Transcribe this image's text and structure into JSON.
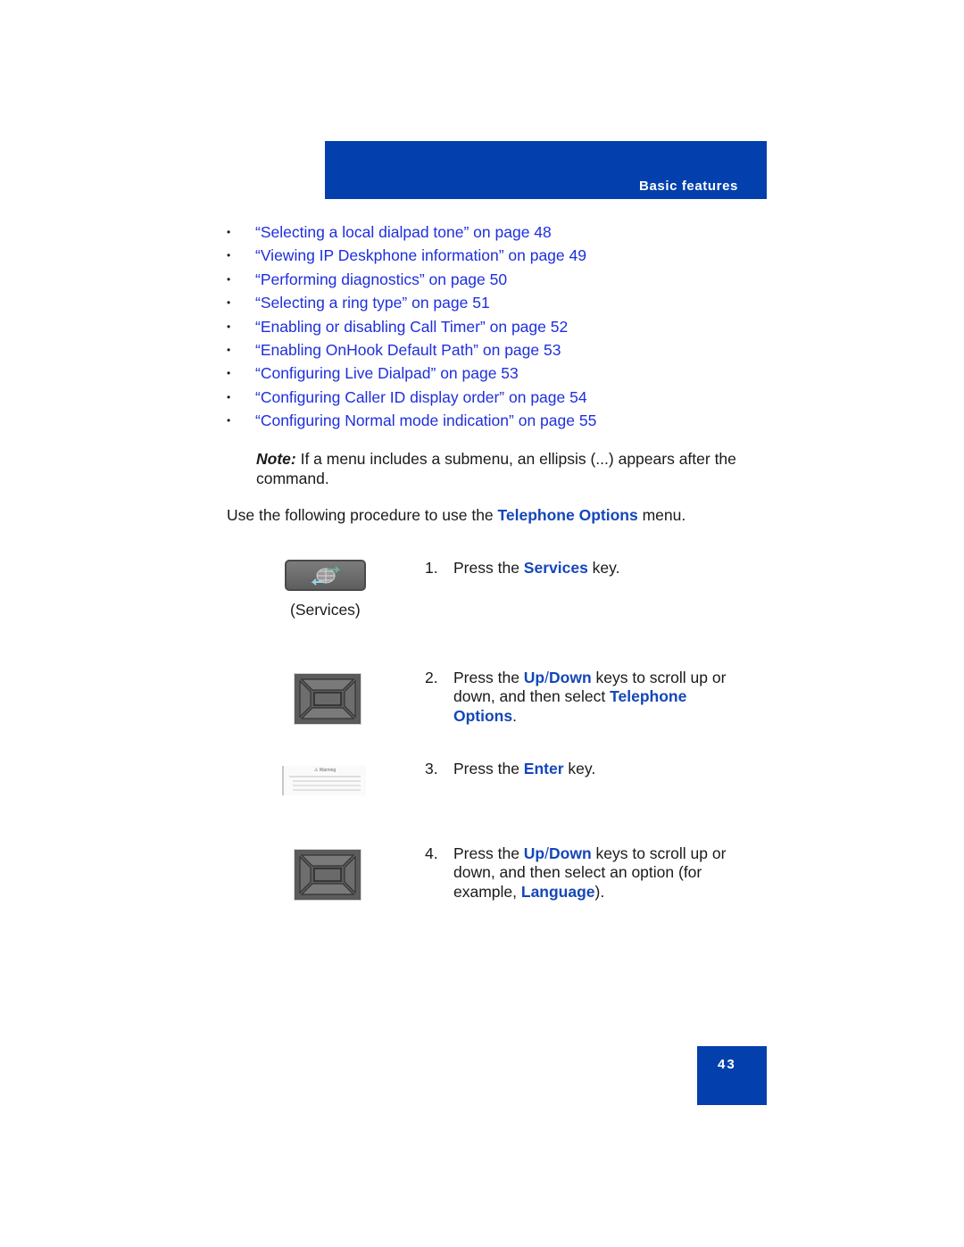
{
  "header": {
    "section_title": "Basic features"
  },
  "toc_links": [
    {
      "label": "“Selecting a local dialpad tone” on page 48"
    },
    {
      "label": "“Viewing IP Deskphone information” on page 49"
    },
    {
      "label": "“Performing diagnostics” on page 50"
    },
    {
      "label": "“Selecting a ring type” on page 51"
    },
    {
      "label": "“Enabling or disabling Call Timer” on page 52"
    },
    {
      "label": "“Enabling OnHook Default Path” on page 53"
    },
    {
      "label": "“Configuring Live Dialpad” on page 53"
    },
    {
      "label": "“Configuring Caller ID display order” on page 54"
    },
    {
      "label": "“Configuring Normal mode indication” on page 55"
    }
  ],
  "bullet_char": "•",
  "note": {
    "label": "Note:",
    "text": " If a menu includes a submenu, an ellipsis (...) appears after the command."
  },
  "intro": {
    "before": "Use the following procedure to use the ",
    "highlight": "Telephone Options",
    "after": " menu."
  },
  "images": {
    "services_key_label": "(Services)",
    "warning_caption": "Warning"
  },
  "steps": [
    {
      "num": "1.",
      "before": "Press the ",
      "hl1": "Services",
      "mid": " key.",
      "hl2": "",
      "after": ""
    },
    {
      "num": "2.",
      "before": "Press the ",
      "hl1": "Up",
      "slash": "/",
      "hl1b": "Down",
      "mid": " keys to scroll up or down, and then select ",
      "hl2": "Telephone Options",
      "after": "."
    },
    {
      "num": "3.",
      "before": "Press the ",
      "hl1": "Enter",
      "mid": " key.",
      "hl2": "",
      "after": ""
    },
    {
      "num": "4.",
      "before": "Press the ",
      "hl1": "Up",
      "slash": "/",
      "hl1b": "Down",
      "mid": " keys to scroll up or down, and then select an option (for example, ",
      "hl2": "Language",
      "after": ")."
    }
  ],
  "footer": {
    "page_number": "43"
  },
  "colors": {
    "brand_blue": "#0340ad",
    "link_blue": "#1f2fdc",
    "highlight_blue": "#1447b8"
  }
}
